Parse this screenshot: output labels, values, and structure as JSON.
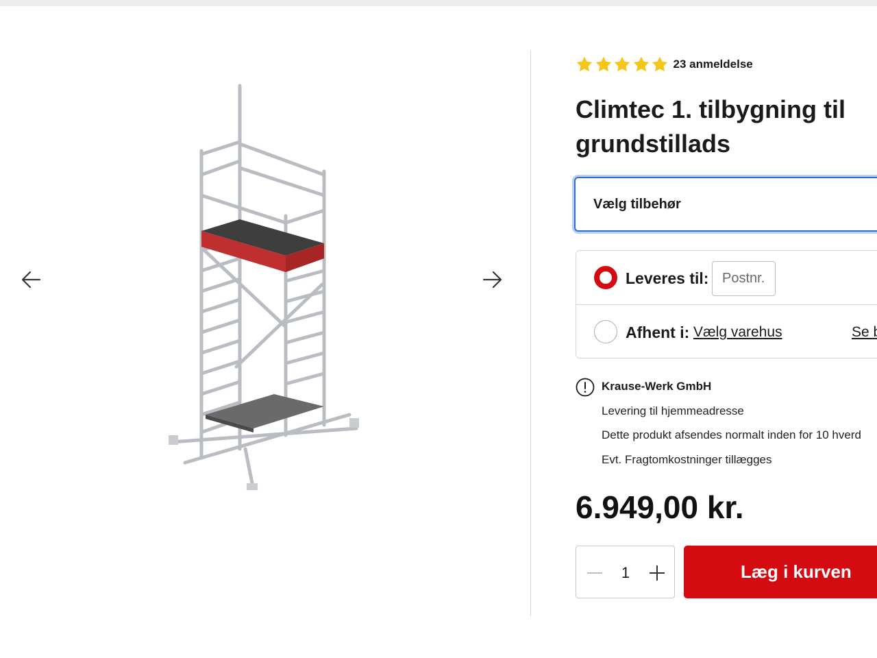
{
  "product": {
    "rating": {
      "stars": 5,
      "max_stars": 5,
      "reviews_label": "23 anmeldelse"
    },
    "title": "Climtec 1. tilbygning til grundstillads",
    "title_line1": "Climtec 1. tilbygning til",
    "title_line2": "grundstillads",
    "accessory_select_label": "Vælg tilbehør",
    "price": "6.949,00 kr.",
    "quantity": "1",
    "add_to_cart_label": "Læg i kurven"
  },
  "delivery": {
    "deliver_label": "Leveres til:",
    "postcode_placeholder": "Postnr.",
    "pickup_label": "Afhent i:",
    "pickup_store_link": "Vælg varehus",
    "see_more_link": "Se b",
    "selected_option": "deliver"
  },
  "seller": {
    "name": "Krause-Werk GmbH",
    "lines": [
      "Levering til hjemmeadresse",
      "Dette produkt afsendes normalt inden for 10 hverd",
      "Evt. Fragtomkostninger tillægges"
    ]
  },
  "colors": {
    "accent_red": "#d40c12",
    "focus_blue": "#2d6dd1",
    "star_yellow": "#f5c518"
  },
  "icons": {
    "prev": "arrow-left-icon",
    "next": "arrow-right-icon",
    "star": "star-icon",
    "info": "exclamation-circle-icon",
    "minus": "minus-icon",
    "plus": "plus-icon"
  }
}
